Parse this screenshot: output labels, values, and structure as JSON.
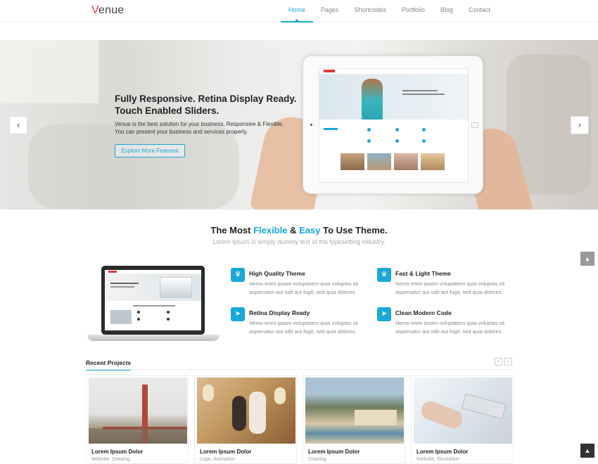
{
  "brand": {
    "logo_initial": "V",
    "logo_rest": "enue"
  },
  "nav": {
    "items": [
      "Home",
      "Pages",
      "Shortcodes",
      "Portfolio",
      "Blog",
      "Contact"
    ],
    "active": "Home"
  },
  "hero": {
    "title": "Fully Responsive. Retina Display Ready. Touch Enabled Sliders.",
    "text": "Venue is the best solution for your business, Responsive & Flexible, You can present your business and services properly.",
    "button": "Explore More Features",
    "prev_icon": "chevron-left-icon",
    "next_icon": "chevron-right-icon"
  },
  "intro": {
    "title_1": "The Most ",
    "title_hl1": "Flexible",
    "title_2": " & ",
    "title_hl2": "Easy",
    "title_3": " To Use Theme.",
    "subtitle": "Lorem Ipsum is simply dummy text of the typesetting industry."
  },
  "features": [
    {
      "title": "High Quality Theme",
      "text": "Nemo enim ipsam voluptatem quia voluptas sit aspernatur aut odit aut fugit, sed quia dolores.",
      "icon": "trophy-icon"
    },
    {
      "title": "Fast & Light Theme",
      "text": "Nemo enim ipsam voluptatem quia voluptas sit aspernatur aut odit aut fugit, sed quia dolores.",
      "icon": "trophy-icon"
    },
    {
      "title": "Retina Display Ready",
      "text": "Nemo enim ipsam voluptatem quia voluptas sit aspernatur aut odit aut fugit, sed quia dolores.",
      "icon": "rocket-icon"
    },
    {
      "title": "Clean Modern Code",
      "text": "Nemo enim ipsam voluptatem quia voluptas sit aspernatur aut odit aut fugit, sed quia dolores.",
      "icon": "rocket-icon"
    }
  ],
  "recent": {
    "title": "Recent Projects",
    "projects": [
      {
        "title": "Lorem Ipsum Dolor",
        "category": "Website, Drawing"
      },
      {
        "title": "Lorem Ipsum Dolor",
        "category": "Logo, Animation"
      },
      {
        "title": "Lorem Ipsum Dolor",
        "category": "Drawing"
      },
      {
        "title": "Lorem Ipsum Dolor",
        "category": "Website, Illustration"
      }
    ]
  },
  "colors": {
    "accent": "#1aa8d8",
    "logo_red": "#e03a3e"
  }
}
